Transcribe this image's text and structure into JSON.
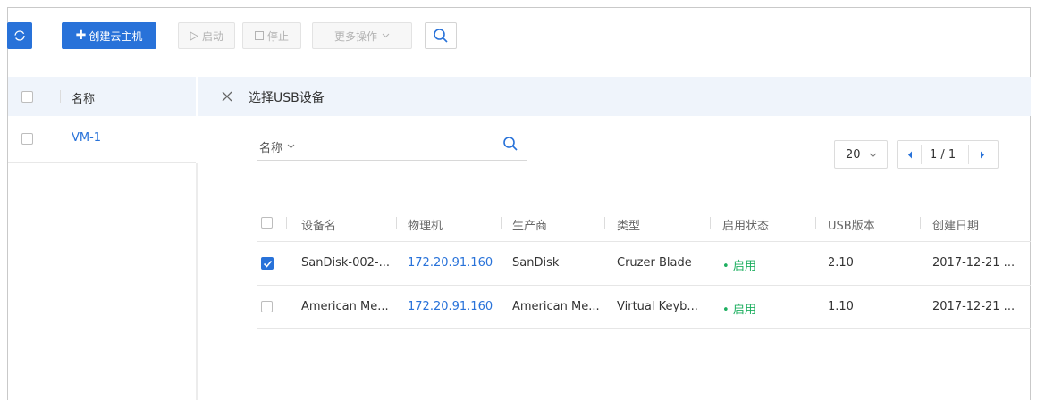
{
  "toolbar": {
    "create_label": "创建云主机",
    "start_label": "启动",
    "stop_label": "停止",
    "more_label": "更多操作"
  },
  "vm_list": {
    "header_name": "名称",
    "rows": [
      {
        "name": "VM-1"
      }
    ]
  },
  "panel": {
    "title": "选择USB设备",
    "filter_label": "名称",
    "page_size": "20",
    "page_indicator": "1 / 1"
  },
  "usb_table": {
    "columns": [
      "设备名",
      "物理机",
      "生产商",
      "类型",
      "启用状态",
      "USB版本",
      "创建日期"
    ],
    "rows": [
      {
        "checked": true,
        "device": "SanDisk-002-...",
        "host": "172.20.91.160",
        "vendor": "SanDisk",
        "type": "Cruzer Blade",
        "status": "启用",
        "usb_version": "2.10",
        "created": "2017-12-21 ..."
      },
      {
        "checked": false,
        "device": "American Me...",
        "host": "172.20.91.160",
        "vendor": "American Me...",
        "type": "Virtual Keyb...",
        "status": "启用",
        "usb_version": "1.10",
        "created": "2017-12-21 ..."
      }
    ]
  },
  "colors": {
    "accent": "#2872d9",
    "status_green": "#1eaf60",
    "header_bg": "#eff4fb"
  },
  "icons": [
    "refresh-icon",
    "plus-icon",
    "play-icon",
    "stop-icon",
    "chevron-down-icon",
    "search-icon",
    "close-icon",
    "check-icon",
    "prev-page-icon",
    "next-page-icon"
  ]
}
